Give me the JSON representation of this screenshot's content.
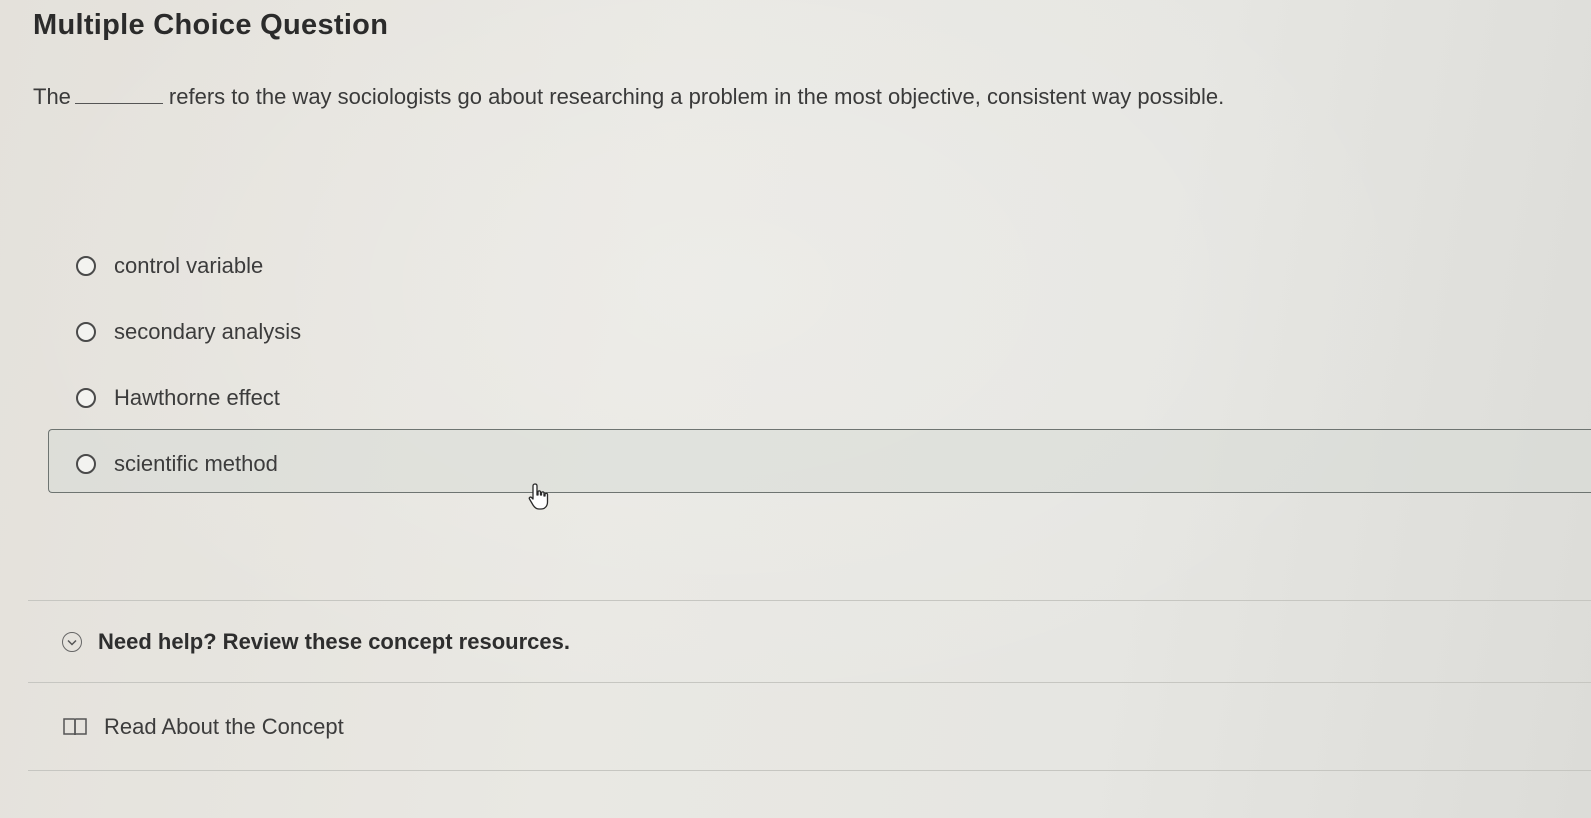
{
  "page": {
    "title": "Multiple Choice Question"
  },
  "question": {
    "prefix": "The",
    "suffix": "refers to the way sociologists go about researching a problem in the most objective, consistent way possible."
  },
  "options": [
    {
      "label": "control variable"
    },
    {
      "label": "secondary analysis"
    },
    {
      "label": "Hawthorne effect"
    },
    {
      "label": "scientific method"
    }
  ],
  "help": {
    "label": "Need help? Review these concept resources."
  },
  "resources": {
    "read_label": "Read About the Concept"
  },
  "colors": {
    "highlight_border": "#6e7471",
    "text": "#3a3a3a"
  }
}
